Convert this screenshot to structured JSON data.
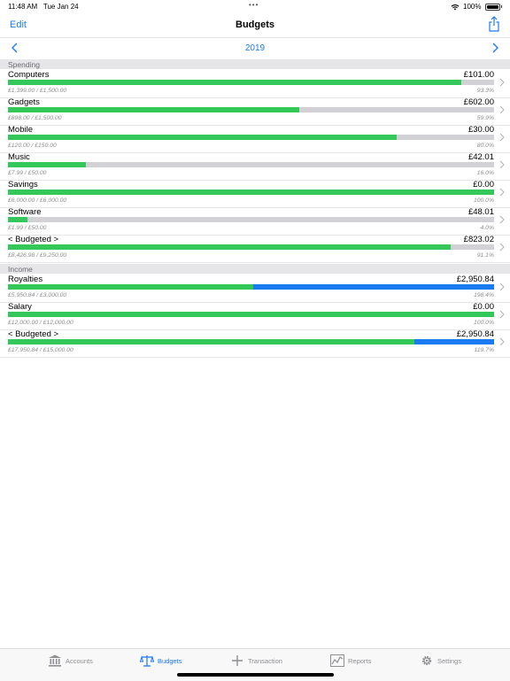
{
  "status": {
    "time": "11:48 AM",
    "date": "Tue Jan 24",
    "battery": "100%"
  },
  "nav": {
    "edit": "Edit",
    "title": "Budgets"
  },
  "year": "2019",
  "sections": [
    {
      "title": "Spending",
      "rows": [
        {
          "name": "Computers",
          "amount": "£101.00",
          "detail": "£1,399.00 / £1,500.00",
          "pct": "93.3%",
          "green": 0.933,
          "blue": 0
        },
        {
          "name": "Gadgets",
          "amount": "£602.00",
          "detail": "£898.00 / £1,500.00",
          "pct": "59.9%",
          "green": 0.599,
          "blue": 0
        },
        {
          "name": "Mobile",
          "amount": "£30.00",
          "detail": "£120.00 / £150.00",
          "pct": "80.0%",
          "green": 0.8,
          "blue": 0
        },
        {
          "name": "Music",
          "amount": "£42.01",
          "detail": "£7.99 / £50.00",
          "pct": "16.0%",
          "green": 0.16,
          "blue": 0
        },
        {
          "name": "Savings",
          "amount": "£0.00",
          "detail": "£6,000.00 / £6,000.00",
          "pct": "100.0%",
          "green": 1.0,
          "blue": 0
        },
        {
          "name": "Software",
          "amount": "£48.01",
          "detail": "£1.99 / £50.00",
          "pct": "4.0%",
          "green": 0.04,
          "blue": 0
        },
        {
          "name": "< Budgeted >",
          "amount": "£823.02",
          "detail": "£8,426.98 / £9,250.00",
          "pct": "91.1%",
          "green": 0.911,
          "blue": 0
        }
      ]
    },
    {
      "title": "Income",
      "rows": [
        {
          "name": "Royalties",
          "amount": "£2,950.84",
          "detail": "£5,950.84 / £3,000.00",
          "pct": "198.4%",
          "green": 0.504,
          "blue": 0.496
        },
        {
          "name": "Salary",
          "amount": "£0.00",
          "detail": "£12,000.00 / £12,000.00",
          "pct": "100.0%",
          "green": 1.0,
          "blue": 0
        },
        {
          "name": "< Budgeted >",
          "amount": "£2,950.84",
          "detail": "£17,950.84 / £15,000.00",
          "pct": "119.7%",
          "green": 0.836,
          "blue": 0.164
        }
      ]
    }
  ],
  "tabs": [
    {
      "label": "Accounts",
      "icon": "bank-icon",
      "active": false
    },
    {
      "label": "Budgets",
      "icon": "scales-icon",
      "active": true
    },
    {
      "label": "Transaction",
      "icon": "plus-icon",
      "active": false
    },
    {
      "label": "Reports",
      "icon": "chart-icon",
      "active": false
    },
    {
      "label": "Settings",
      "icon": "gear-icon",
      "active": false
    }
  ],
  "colors": {
    "accent": "#1a7bf0",
    "green": "#34c759",
    "track": "#d2d2d6"
  }
}
